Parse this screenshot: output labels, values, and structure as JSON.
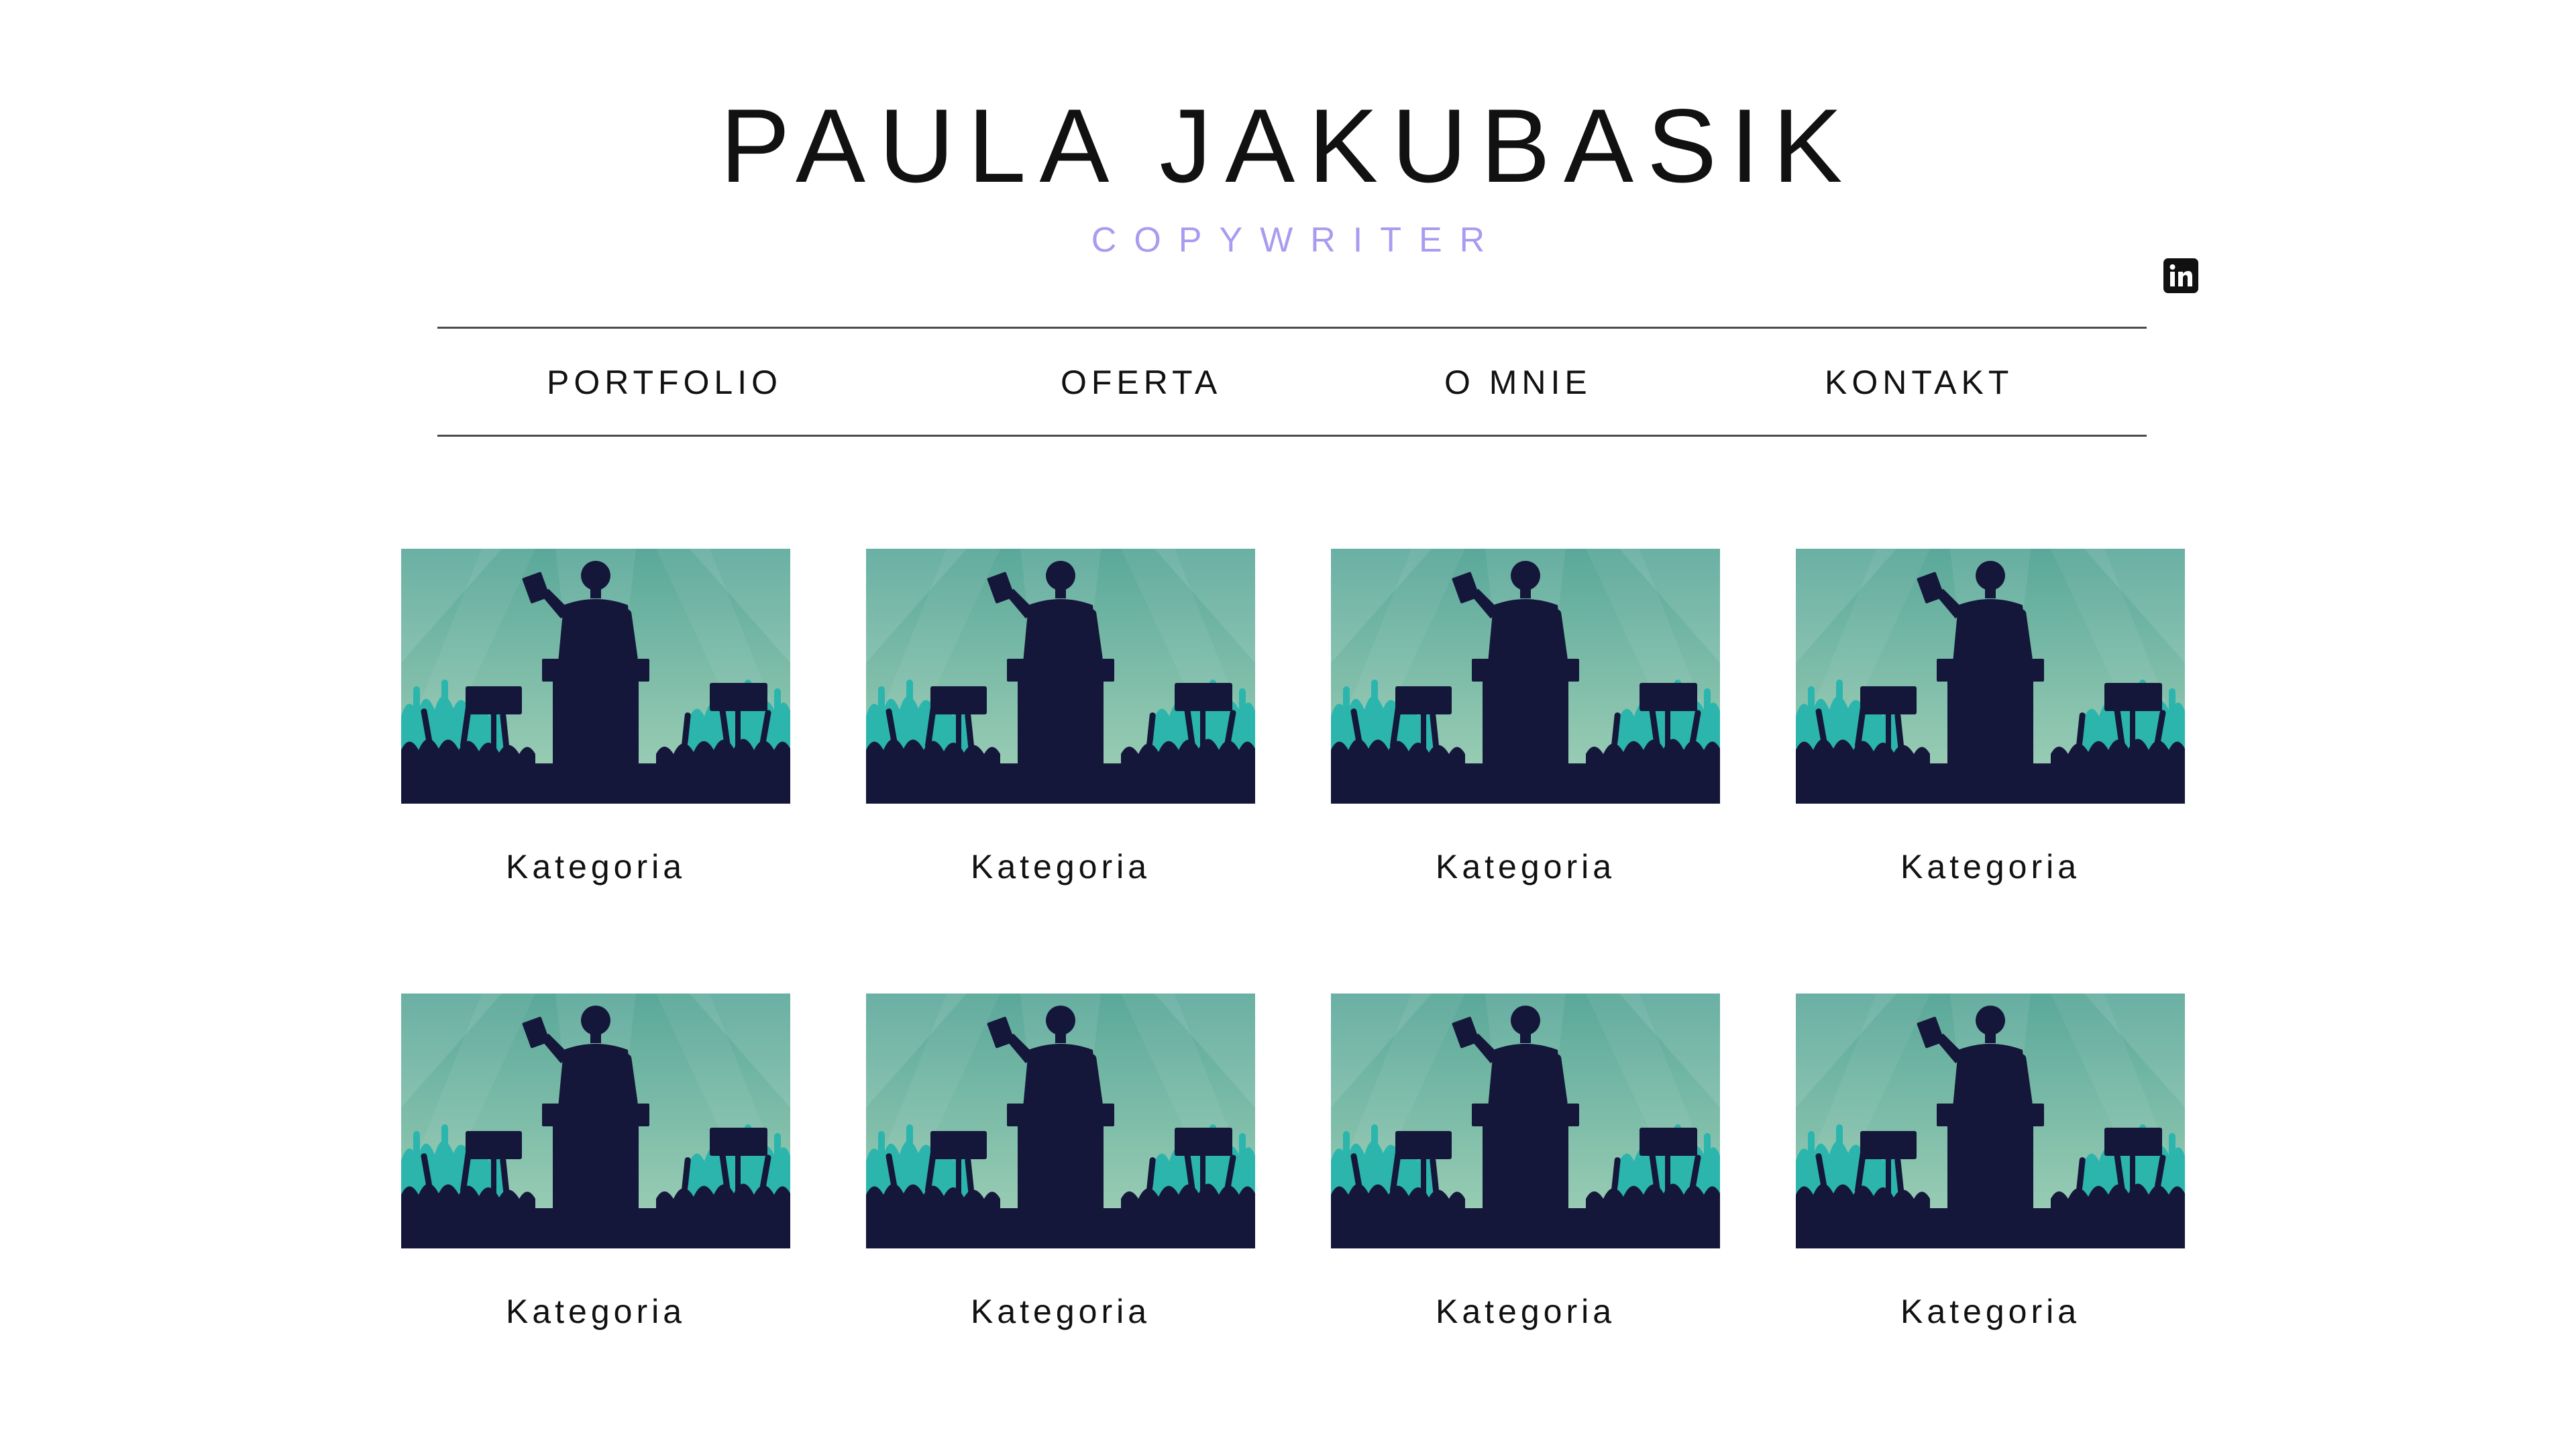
{
  "header": {
    "title": "PAULA JAKUBASIK",
    "subtitle": "COPYWRITER",
    "social_icon": "linkedin-icon"
  },
  "nav": {
    "items": [
      {
        "label": "PORTFOLIO"
      },
      {
        "label": "OFERTA"
      },
      {
        "label": "O MNIE"
      },
      {
        "label": "KONTAKT"
      }
    ]
  },
  "portfolio": {
    "cards": [
      {
        "label": "Kategoria",
        "image": "speaker-at-podium-with-crowd-illustration"
      },
      {
        "label": "Kategoria",
        "image": "speaker-at-podium-with-crowd-illustration"
      },
      {
        "label": "Kategoria",
        "image": "speaker-at-podium-with-crowd-illustration"
      },
      {
        "label": "Kategoria",
        "image": "speaker-at-podium-with-crowd-illustration"
      },
      {
        "label": "Kategoria",
        "image": "speaker-at-podium-with-crowd-illustration"
      },
      {
        "label": "Kategoria",
        "image": "speaker-at-podium-with-crowd-illustration"
      },
      {
        "label": "Kategoria",
        "image": "speaker-at-podium-with-crowd-illustration"
      },
      {
        "label": "Kategoria",
        "image": "speaker-at-podium-with-crowd-illustration"
      }
    ]
  },
  "colors": {
    "subtitle": "#a89cf0",
    "text": "#111111",
    "rule": "#4a4a4a",
    "illustration_sky_top": "#5aa89a",
    "illustration_sky_bottom": "#a3d2b8",
    "illustration_crowd": "#2bb5ad",
    "illustration_silhouette": "#15173a"
  }
}
